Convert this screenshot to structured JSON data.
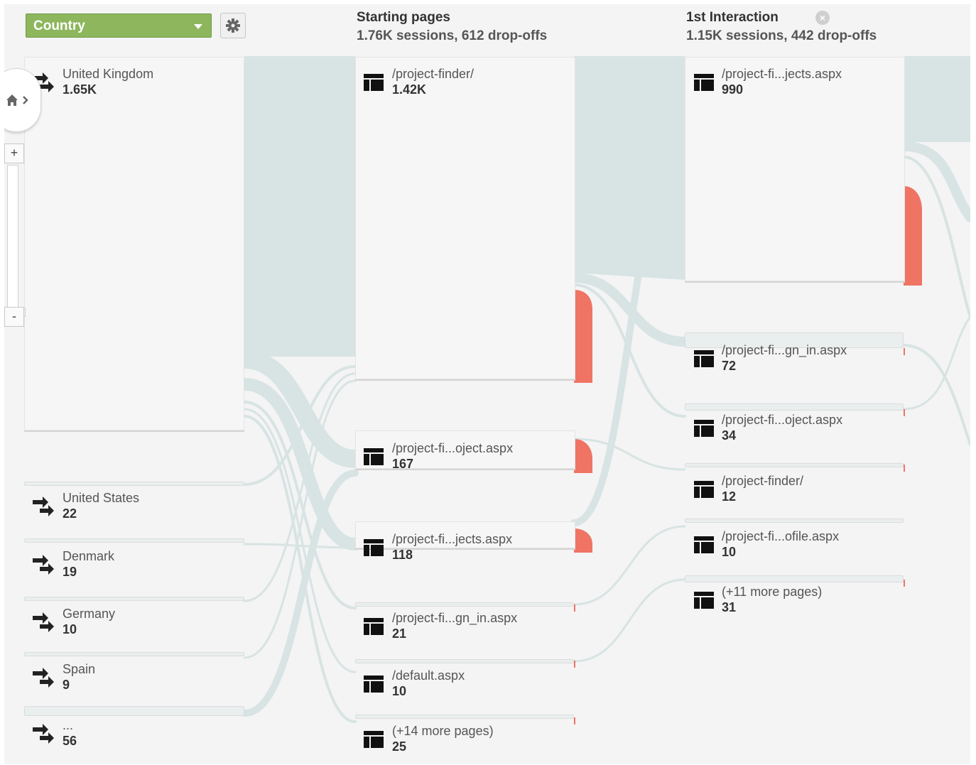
{
  "dimension_selector": {
    "label": "Country"
  },
  "colors": {
    "flow": "#d8e3e3",
    "dropoff": "#ef7464",
    "dimension": "#8db65d"
  },
  "columns": [
    {
      "title": "Starting pages",
      "subtitle": "1.76K sessions, 612 drop-offs"
    },
    {
      "title": "1st Interaction",
      "subtitle": "1.15K sessions, 442 drop-offs"
    }
  ],
  "countries": [
    {
      "name": "United Kingdom",
      "value": "1.65K"
    },
    {
      "name": "United States",
      "value": "22"
    },
    {
      "name": "Denmark",
      "value": "19"
    },
    {
      "name": "Germany",
      "value": "10"
    },
    {
      "name": "Spain",
      "value": "9"
    },
    {
      "name": "...",
      "value": "56"
    }
  ],
  "starting_pages": [
    {
      "name": "/project-finder/",
      "value": "1.42K"
    },
    {
      "name": "/project-fi...oject.aspx",
      "value": "167"
    },
    {
      "name": "/project-fi...jects.aspx",
      "value": "118"
    },
    {
      "name": "/project-fi...gn_in.aspx",
      "value": "21"
    },
    {
      "name": "/default.aspx",
      "value": "10"
    },
    {
      "name": "(+14 more pages)",
      "value": "25"
    }
  ],
  "first_interaction": [
    {
      "name": "/project-fi...jects.aspx",
      "value": "990"
    },
    {
      "name": "/project-fi...gn_in.aspx",
      "value": "72"
    },
    {
      "name": "/project-fi...oject.aspx",
      "value": "34"
    },
    {
      "name": "/project-finder/",
      "value": "12"
    },
    {
      "name": "/project-fi...ofile.aspx",
      "value": "10"
    },
    {
      "name": "(+11 more pages)",
      "value": "31"
    }
  ],
  "zoom": {
    "plus": "+",
    "minus": "-"
  }
}
